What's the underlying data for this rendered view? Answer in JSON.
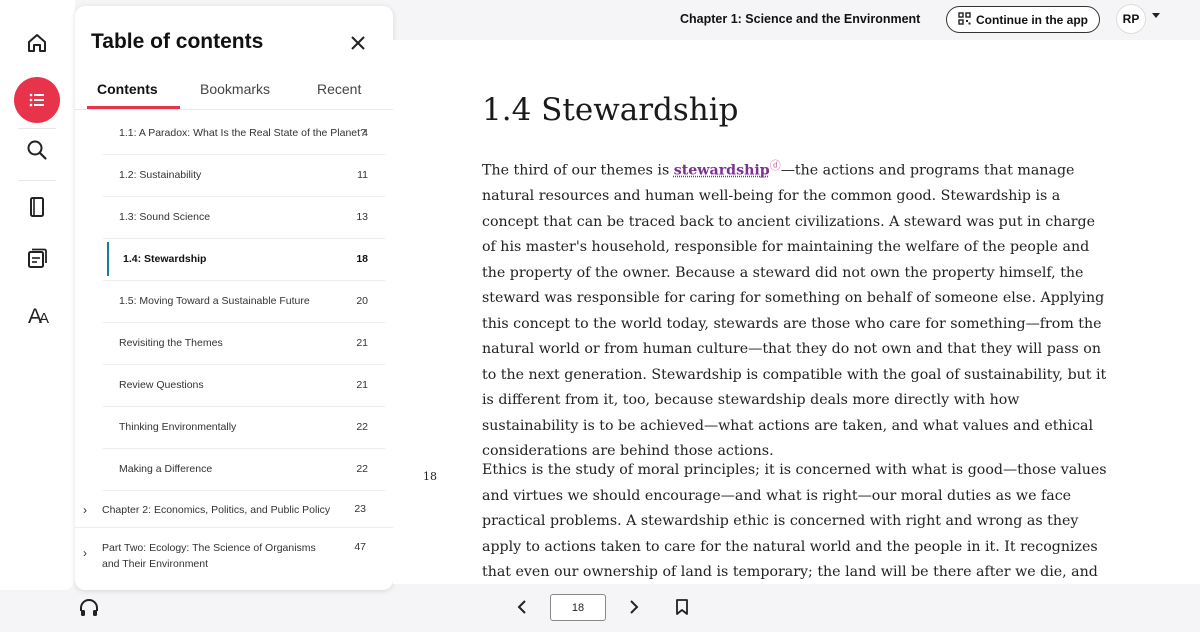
{
  "rail": {
    "items": [
      {
        "icon": "home-icon"
      },
      {
        "icon": "table-of-contents-icon",
        "active": true
      },
      {
        "icon": "search-icon"
      },
      {
        "icon": "notebook-icon"
      },
      {
        "icon": "flashcards-icon"
      },
      {
        "icon": "text-settings-icon",
        "glyph": "AA"
      }
    ]
  },
  "toc": {
    "title": "Table of contents",
    "tabs": [
      {
        "label": "Contents",
        "active": true
      },
      {
        "label": "Bookmarks",
        "active": false
      },
      {
        "label": "Recent",
        "active": false
      }
    ],
    "sections": [
      {
        "label": "1.1: A Paradox: What Is the Real State of the Planet?",
        "page": "4"
      },
      {
        "label": "1.2: Sustainability",
        "page": "11"
      },
      {
        "label": "1.3: Sound Science",
        "page": "13"
      },
      {
        "label": "1.4: Stewardship",
        "page": "18",
        "current": true
      },
      {
        "label": "1.5: Moving Toward a Sustainable Future",
        "page": "20"
      },
      {
        "label": "Revisiting the Themes",
        "page": "21"
      },
      {
        "label": "Review Questions",
        "page": "21"
      },
      {
        "label": "Thinking Environmentally",
        "page": "22"
      },
      {
        "label": "Making a Difference",
        "page": "22"
      }
    ],
    "chapters": [
      {
        "label": "Chapter 2: Economics, Politics, and Public Policy",
        "page": "23"
      },
      {
        "label": "Part Two: Ecology: The Science of Organisms and Their Environment",
        "page": "47"
      }
    ]
  },
  "topbar": {
    "chapter_title": "Chapter 1: Science and the Environment",
    "continue_label": "Continue in the app",
    "avatar_initials": "RP"
  },
  "reader": {
    "page_marker": "18",
    "heading": "1.4 Stewardship",
    "para1_before": "The third of our themes is ",
    "para1_term": "stewardship",
    "para1_after": "—the actions and programs that manage natural resources and human well-being for the common good. Stewardship is a concept that can be traced back to ancient civilizations. A steward was put in charge of his master's household, responsible for maintaining the welfare of the people and the property of the owner. Because a steward did not own the property himself, the steward was responsible for caring for something on behalf of someone else. Applying this concept to the world today, stewards are those who care for something—from the natural world or from human culture—that they do not own and that they will pass on to the next generation. Stewardship is compatible with the goal of sustainability, but it is different from it, too, because stewardship deals more directly with how sustainability is to be achieved—what actions are taken, and what values and ethical considerations are behind those actions.",
    "para2": "Ethics is the study of moral principles; it is concerned with what is good—those values and virtues we should encourage—and what is right—our moral duties as we face practical problems. A stewardship ethic is concerned with right and wrong as they apply to actions taken to care for the natural world and the people in it. It recognizes that even our ownership of land is temporary; the land will be there after we die, and others will own it in turn. Because a steward is someone who"
  },
  "bottom_nav": {
    "page_value": "18"
  },
  "colors": {
    "accent": "#e8344a",
    "current_marker": "#1a7f8c",
    "term": "#7d2f94"
  }
}
